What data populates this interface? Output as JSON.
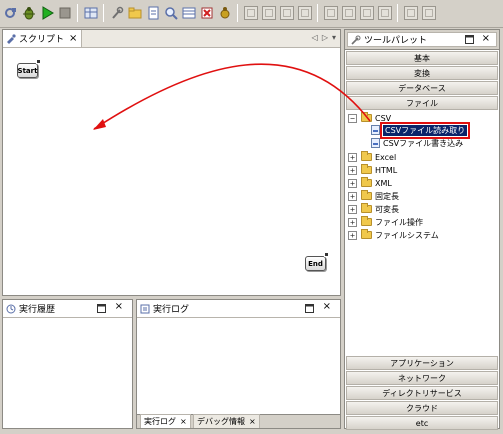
{
  "script_view": {
    "tab_label": "スクリプト",
    "close_glyph": "×",
    "nav_left": "◁",
    "nav_right": "▷",
    "menu": "▾",
    "start_node": "Start",
    "end_node": "End",
    "arrow_color": "#e01010"
  },
  "palette": {
    "title": "ツールパレット",
    "close_glyph": "×",
    "categories_top": [
      "基本",
      "変換",
      "データベース",
      "ファイル"
    ],
    "tree": [
      {
        "label": "CSV",
        "expanded": true,
        "kind": "folder"
      },
      {
        "label": "CSVファイル読み取り",
        "kind": "item",
        "selected": true
      },
      {
        "label": "CSVファイル書き込み",
        "kind": "item"
      },
      {
        "label": "Excel",
        "kind": "folder"
      },
      {
        "label": "HTML",
        "kind": "folder"
      },
      {
        "label": "XML",
        "kind": "folder"
      },
      {
        "label": "固定長",
        "kind": "folder"
      },
      {
        "label": "可変長",
        "kind": "folder"
      },
      {
        "label": "ファイル操作",
        "kind": "folder"
      },
      {
        "label": "ファイルシステム",
        "kind": "folder"
      }
    ],
    "categories_bottom": [
      "アプリケーション",
      "ネットワーク",
      "ディレクトリサービス",
      "クラウド",
      "etc"
    ],
    "highlight_color": "#e01010",
    "selection_color": "#0a246a"
  },
  "history": {
    "title": "実行履歴",
    "close_glyph": "×"
  },
  "log": {
    "title": "実行ログ",
    "close_glyph": "×",
    "bottom_tabs": [
      {
        "label": "実行ログ",
        "close": "×"
      },
      {
        "label": "デバッグ情報",
        "close": "×"
      }
    ]
  }
}
